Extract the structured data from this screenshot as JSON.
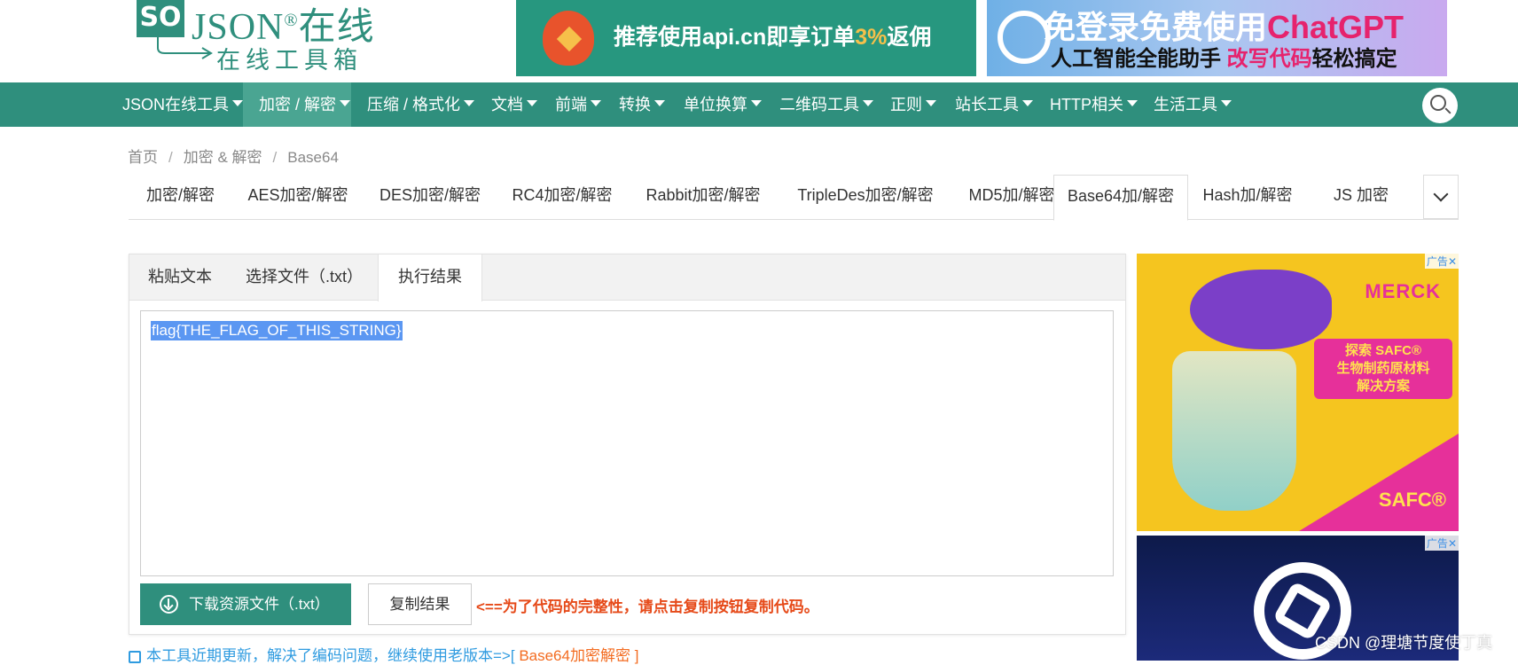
{
  "logo": {
    "so": "SO",
    "json": "JSON",
    "reg": "®",
    "online": "在线",
    "subtitle": "在线工具箱"
  },
  "top_ads": {
    "ad1_text_a": "推荐使用api.cn即享订单",
    "ad1_text_highlight": "3%",
    "ad1_text_b": "返佣",
    "ad2_line1_a": "免登录免费使用",
    "ad2_line1_b": "ChatGPT",
    "ad2_line2_a": "人工智能全能助手 ",
    "ad2_line2_b": "改写代码",
    "ad2_line2_c": "轻松搞定"
  },
  "nav": {
    "items": [
      {
        "label": "JSON在线工具"
      },
      {
        "label": "加密 / 解密"
      },
      {
        "label": "压缩 / 格式化"
      },
      {
        "label": "文档"
      },
      {
        "label": "前端"
      },
      {
        "label": "转换"
      },
      {
        "label": "单位换算"
      },
      {
        "label": "二维码工具"
      },
      {
        "label": "正则"
      },
      {
        "label": "站长工具"
      },
      {
        "label": "HTTP相关"
      },
      {
        "label": "生活工具"
      }
    ],
    "active_index": 1
  },
  "breadcrumb": {
    "home": "首页",
    "sep": "/",
    "category": "加密 & 解密",
    "current": "Base64"
  },
  "subtabs": {
    "items": [
      {
        "label": "加密/解密"
      },
      {
        "label": "AES加密/解密"
      },
      {
        "label": "DES加密/解密"
      },
      {
        "label": "RC4加密/解密"
      },
      {
        "label": "Rabbit加密/解密"
      },
      {
        "label": "TripleDes加密/解密"
      },
      {
        "label": "MD5加/解密"
      },
      {
        "label": "Base64加/解密"
      },
      {
        "label": "Hash加/解密"
      },
      {
        "label": "JS 加密"
      }
    ],
    "active_index": 7
  },
  "panel": {
    "tabs": [
      {
        "label": "粘贴文本"
      },
      {
        "label": "选择文件（.txt）"
      },
      {
        "label": "执行结果"
      }
    ],
    "active_tab": 2,
    "result": "flag{THE_FLAG_OF_THIS_STRING}",
    "download_label": "下载资源文件（.txt）",
    "copy_label": "复制结果",
    "copy_hint": "<==为了代码的完整性，请点击复制按钮复制代码。"
  },
  "footnote": {
    "text": "本工具近期更新，解决了编码问题，继续使用老版本=>[ ",
    "link": "Base64加密解密",
    "close": " ]"
  },
  "side_ads": {
    "tag": "广告",
    "close": "✕",
    "ad1_brand": "MERCK",
    "ad1_box": "探索 SAFC®\n生物制药原材料\n解决方案",
    "ad1_box_l1": "探索 SAFC®",
    "ad1_box_l2": "生物制药原材料",
    "ad1_box_l3": "解决方案",
    "ad1_logo": "SAFC®"
  },
  "watermark": "CSDN @理塘节度使丁真",
  "colors": {
    "primary": "#2f8f7d",
    "nav_active": "#4aa592",
    "hint": "#e64a19",
    "link": "#2f9be0",
    "selection": "#5b97f2"
  }
}
